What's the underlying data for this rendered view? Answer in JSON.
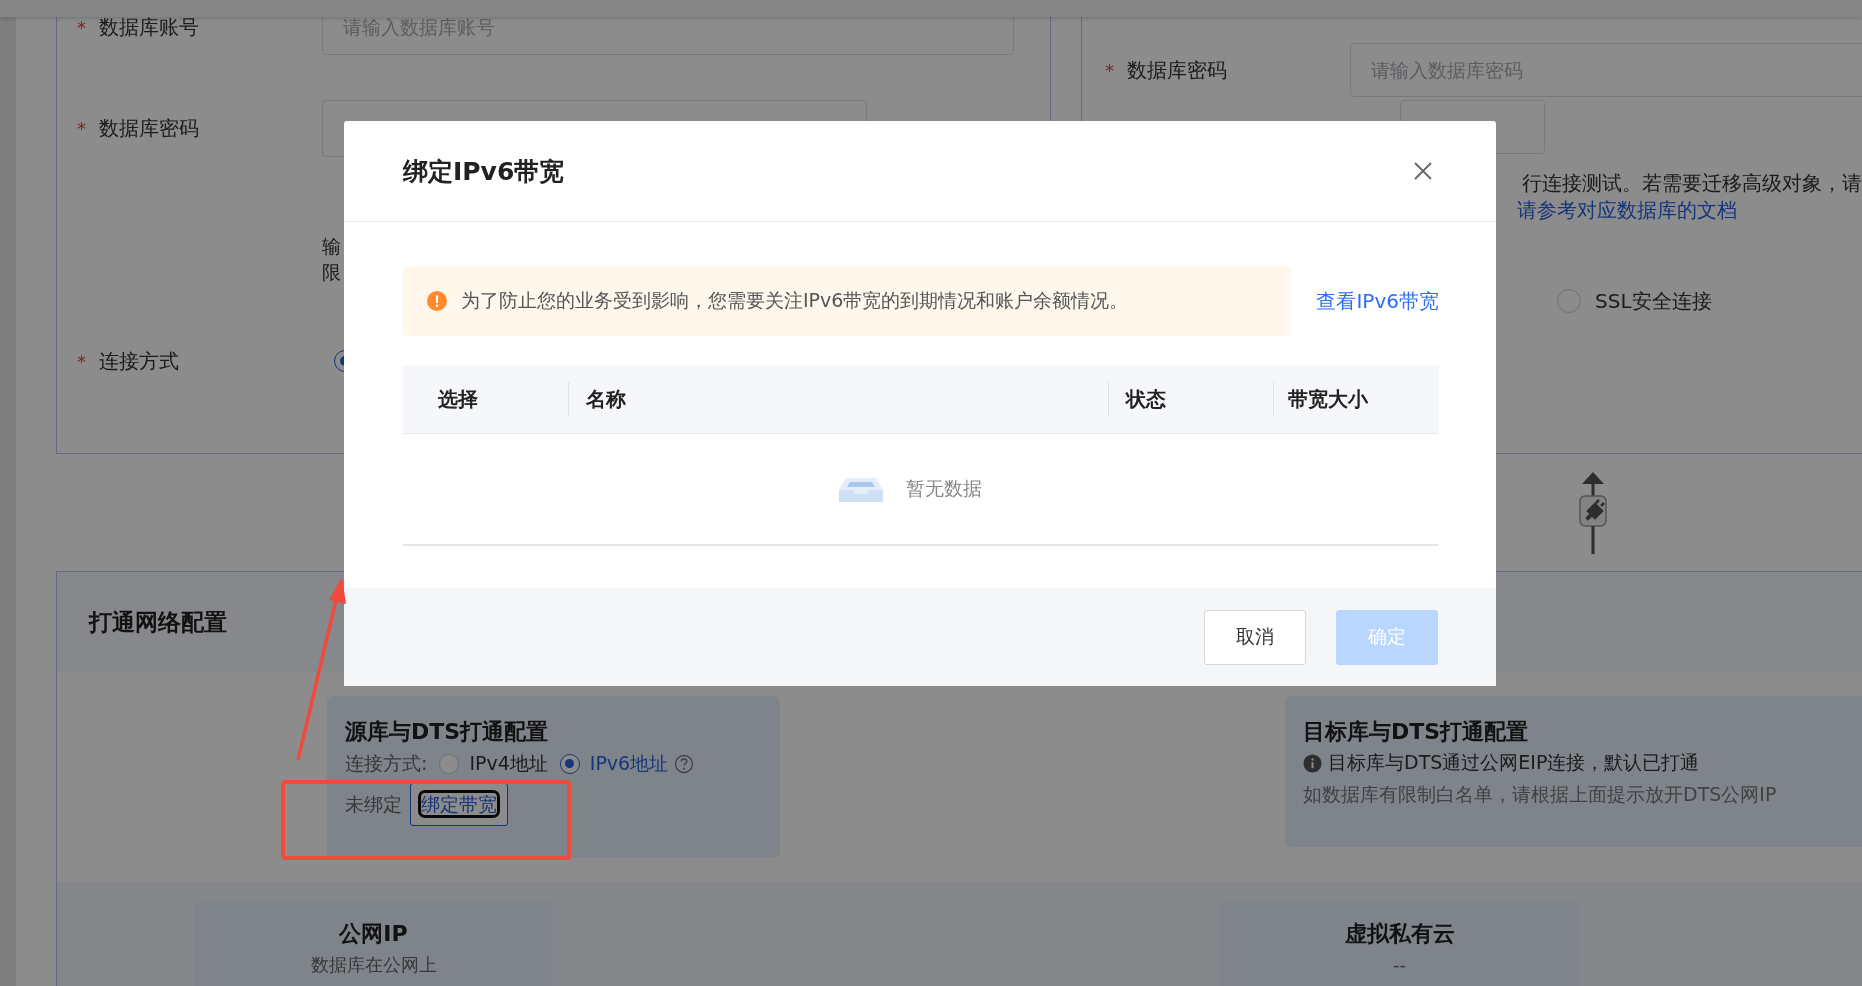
{
  "top_form": {
    "left": {
      "account": {
        "mark": "*",
        "label": "数据库账号",
        "placeholder": "请输入数据库账号"
      },
      "password": {
        "mark": "*",
        "label": "数据库密码"
      },
      "hint_lines": [
        "输",
        "限"
      ],
      "connection": {
        "mark": "*",
        "label": "连接方式",
        "radio_selected": true
      }
    },
    "right": {
      "password": {
        "mark": "*",
        "label": "数据库密码",
        "placeholder": "请输入数据库密码"
      },
      "hint": "行连接测试。若需要迁移高级对象，请",
      "doc_link": "请参考对应数据库的文档",
      "ssl": {
        "label": "SSL安全连接",
        "checked": false
      }
    }
  },
  "network": {
    "title": "打通网络配置",
    "source": {
      "title": "源库与DTS打通配置",
      "connection_label": "连接方式:",
      "options": [
        {
          "label": "IPv4地址",
          "selected": false
        },
        {
          "label": "IPv6地址",
          "selected": true
        }
      ],
      "status": "未绑定",
      "bind_button": "绑定带宽"
    },
    "target": {
      "title": "目标库与DTS打通配置",
      "info": "目标库与DTS通过公网EIP连接，默认已打通",
      "note": "如数据库有限制白名单，请根据上面提示放开DTS公网IP"
    },
    "access_types": [
      {
        "title": "公网IP",
        "subtitle": "数据库在公网上"
      },
      {
        "title": "虚拟私有云",
        "subtitle": "--"
      }
    ]
  },
  "dialog": {
    "title": "绑定IPv6带宽",
    "alert": "为了防止您的业务受到影响，您需要关注IPv6带宽的到期情况和账户余额情况。",
    "alert_link": "查看IPv6带宽",
    "columns": [
      "选择",
      "名称",
      "状态",
      "带宽大小"
    ],
    "empty_text": "暂无数据",
    "buttons": [
      {
        "label": "取消",
        "kind": "default",
        "disabled": false
      },
      {
        "label": "确定",
        "kind": "primary",
        "disabled": true
      }
    ]
  }
}
